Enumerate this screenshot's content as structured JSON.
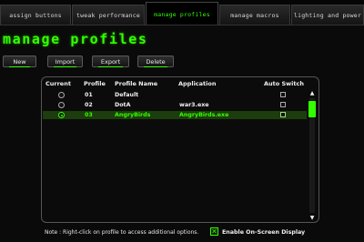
{
  "tabs": [
    {
      "label": "Assign Buttons",
      "active": false
    },
    {
      "label": "Tweak Performance",
      "active": false
    },
    {
      "label": "Manage Profiles",
      "active": true
    },
    {
      "label": "Manage Macros",
      "active": false
    },
    {
      "label": "Lighting and Power",
      "active": false
    }
  ],
  "page_title": "Manage Profiles",
  "toolbar": {
    "new_label": "New",
    "import_label": "Import",
    "export_label": "Export",
    "delete_label": "Delete"
  },
  "table": {
    "columns": [
      "Current",
      "Profile",
      "Profile Name",
      "Application",
      "Auto Switch"
    ],
    "rows": [
      {
        "current": false,
        "profile": "01",
        "name": "Default",
        "application": "",
        "auto_switch": false,
        "selected": false
      },
      {
        "current": false,
        "profile": "02",
        "name": "DotA",
        "application": "war3.exe",
        "auto_switch": false,
        "selected": false
      },
      {
        "current": true,
        "profile": "03",
        "name": "AngryBirds",
        "application": "AngryBirds.exe",
        "auto_switch": false,
        "selected": true
      }
    ]
  },
  "scrollbar": {
    "up_arrow": "▲",
    "down_arrow": "▼"
  },
  "footer": {
    "note": "Note : Right-click on profile to access additional options.",
    "osd_checked": true,
    "osd_mark": "✕",
    "osd_label": "Enable On-Screen Display"
  },
  "colors": {
    "accent": "#33ff00",
    "background": "#0a0a0a",
    "selected_row": "#1c3d0d"
  }
}
